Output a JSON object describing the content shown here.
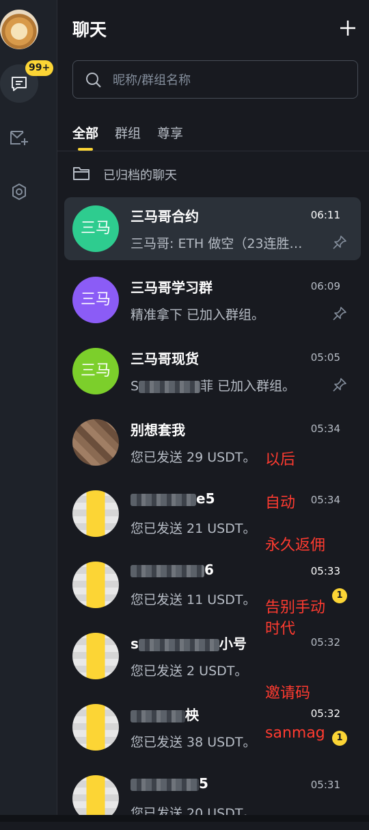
{
  "header": {
    "title": "聊天"
  },
  "rail": {
    "badge": "99+"
  },
  "search": {
    "placeholder": "昵称/群组名称"
  },
  "tabs": [
    {
      "label": "全部",
      "active": true
    },
    {
      "label": "群组",
      "active": false
    },
    {
      "label": "尊享",
      "active": false
    }
  ],
  "archived": {
    "label": "已归档的聊天"
  },
  "chats": [
    {
      "avatar_text": "三马",
      "avatar_color": "#2ecc8f",
      "name": "三马哥合约",
      "time": "06:11",
      "preview": "三马哥: ETH 做空（23连胜…",
      "pinned": true
    },
    {
      "avatar_text": "三马",
      "avatar_color": "#8b5cf6",
      "name": "三马哥学习群",
      "time": "06:09",
      "preview": "精准拿下 已加入群组。",
      "pinned": true
    },
    {
      "avatar_text": "三马",
      "avatar_color": "#7ccf2b",
      "name": "三马哥现货",
      "time": "05:05",
      "preview_prefix": "S",
      "preview": "菲 已加入群组。",
      "pinned": true
    },
    {
      "name": "别想套我",
      "time": "05:34",
      "preview": "您已发送 29 USDT。"
    },
    {
      "name": "e5",
      "time": "05:34",
      "preview": "您已发送 21 USDT。"
    },
    {
      "name": "6",
      "time": "05:33",
      "preview": "您已发送 11 USDT。",
      "unread": "1"
    },
    {
      "name_prefix": "s",
      "name": "小号",
      "time": "05:32",
      "preview": "您已发送 2 USDT。"
    },
    {
      "name": "柍",
      "time": "05:32",
      "preview": "您已发送 38 USDT。",
      "unread": "1"
    },
    {
      "name": "5",
      "time": "05:31",
      "preview": "您已发送 20 USDT。"
    }
  ],
  "overlay_text": [
    "以后",
    "自动",
    "永久返佣",
    "告别手动",
    "时代",
    "邀请码",
    "sanmag"
  ],
  "colors": {
    "accent": "#fcd535",
    "background": "#181a20",
    "overlay": "#ff3b30"
  }
}
